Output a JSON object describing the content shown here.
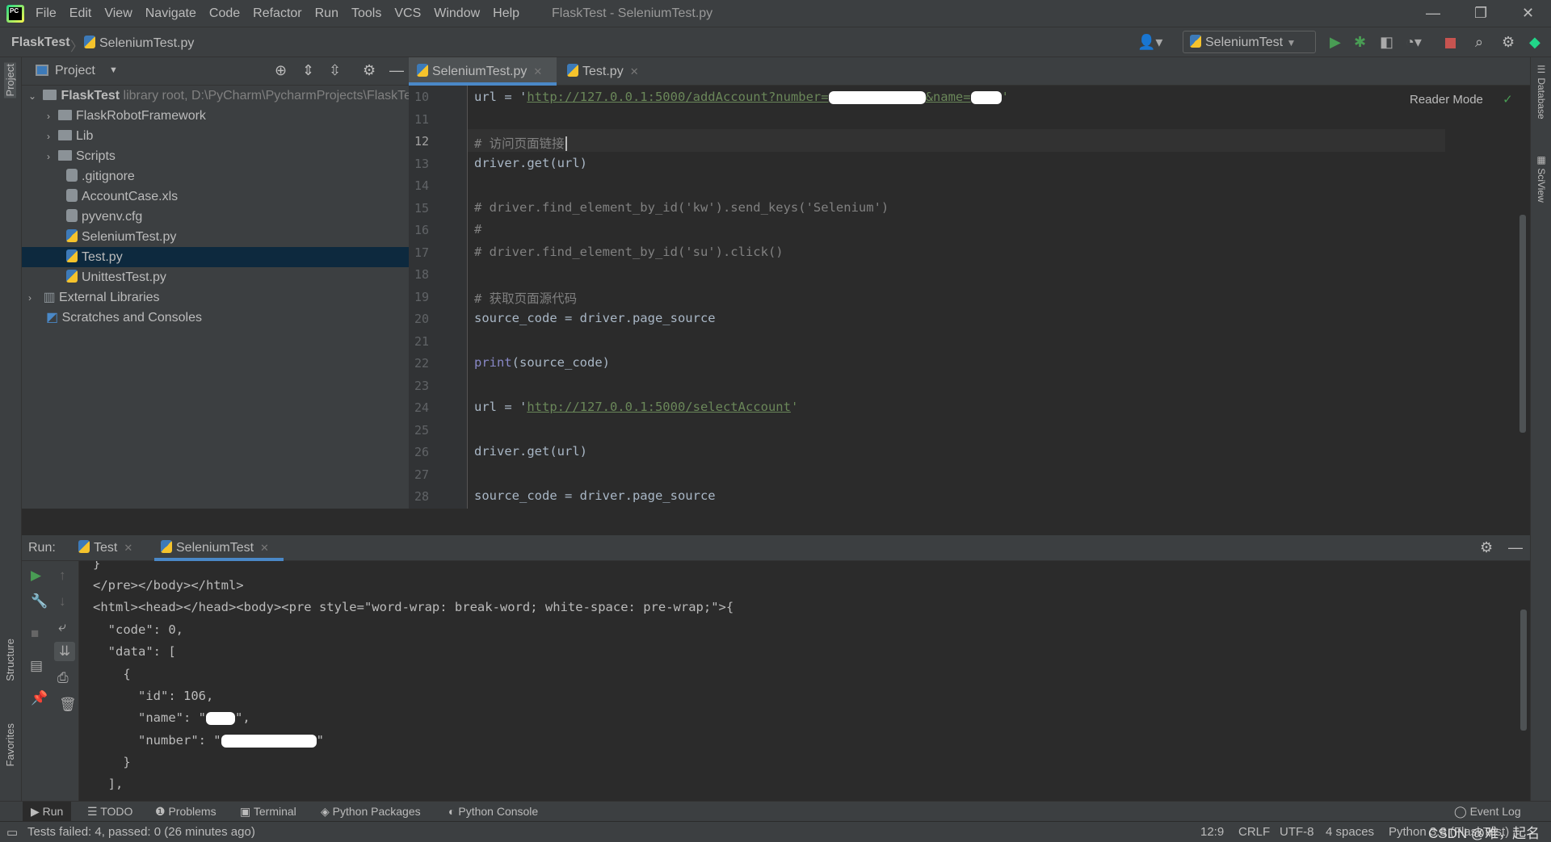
{
  "menubar": {
    "items": [
      "File",
      "Edit",
      "View",
      "Navigate",
      "Code",
      "Refactor",
      "Run",
      "Tools",
      "VCS",
      "Window",
      "Help"
    ],
    "title": "FlaskTest - SeleniumTest.py",
    "logo": "PC"
  },
  "navbar": {
    "project": "FlaskTest",
    "file": "SeleniumTest.py",
    "run_config": "SeleniumTest"
  },
  "project_panel": {
    "title": "Project",
    "items": [
      {
        "label": "FlaskTest",
        "extra": "library root,  D:\\PyCharm\\PycharmProjects\\FlaskTest",
        "type": "root"
      },
      {
        "label": "FlaskRobotFramework",
        "type": "folder"
      },
      {
        "label": "Lib",
        "type": "folder"
      },
      {
        "label": "Scripts",
        "type": "folder"
      },
      {
        "label": ".gitignore",
        "type": "file"
      },
      {
        "label": "AccountCase.xls",
        "type": "file"
      },
      {
        "label": "pyvenv.cfg",
        "type": "file"
      },
      {
        "label": "SeleniumTest.py",
        "type": "py"
      },
      {
        "label": "Test.py",
        "type": "py",
        "selected": true
      },
      {
        "label": "UnittestTest.py",
        "type": "py"
      },
      {
        "label": "External Libraries",
        "type": "lib"
      },
      {
        "label": "Scratches and Consoles",
        "type": "scratch"
      }
    ]
  },
  "editor": {
    "tabs": [
      "SeleniumTest.py",
      "Test.py"
    ],
    "active_tab": "SeleniumTest.py",
    "reader_mode": "Reader Mode",
    "line_numbers": [
      "10",
      "11",
      "12",
      "13",
      "14",
      "15",
      "16",
      "17",
      "18",
      "19",
      "20",
      "21",
      "22",
      "23",
      "24",
      "25",
      "26",
      "27",
      "28"
    ],
    "lines": {
      "l10a": "url = '",
      "l10b": "http://127.0.0.1:5000/addAccount?number=",
      "l10c": "&name=",
      "l12": "# 访问页面链接",
      "l13": "driver.get(url)",
      "l15": "# driver.find_element_by_id('kw').send_keys('Selenium')",
      "l16": "#",
      "l17": "# driver.find_element_by_id('su').click()",
      "l19": "# 获取页面源代码",
      "l20": "source_code = driver.page_source",
      "l22a": "print",
      "l22b": "(source_code)",
      "l24a": "url = '",
      "l24b": "http://127.0.0.1:5000/selectAccount",
      "l24c": "'",
      "l26": "driver.get(url)",
      "l28": "source_code = driver.page_source"
    }
  },
  "run_panel": {
    "label": "Run:",
    "tabs": [
      "Test",
      "SeleniumTest"
    ],
    "active_tab": "SeleniumTest",
    "output": [
      "}",
      "</pre></body></html>",
      "<html><head></head><body><pre style=\"word-wrap: break-word; white-space: pre-wrap;\">{",
      "  \"code\": 0,",
      "  \"data\": [",
      "    {",
      "      \"id\": 106,",
      "      \"name\": \"",
      "      \"number\": \"",
      "    }",
      "  ],"
    ]
  },
  "tool_windows": [
    "Run",
    "TODO",
    "Problems",
    "Terminal",
    "Python Packages",
    "Python Console"
  ],
  "event_log": "Event Log",
  "side_labels": {
    "project": "Project",
    "structure": "Structure",
    "favorites": "Favorites",
    "database": "Database",
    "sciview": "SciView"
  },
  "status": {
    "message": "Tests failed: 4, passed: 0 (26 minutes ago)",
    "position": "12:9",
    "line_sep": "CRLF",
    "encoding": "UTF-8",
    "indent": "4 spaces",
    "interpreter": "Python 3.8 (FlaskTest)",
    "watermark": "CSDN @难，起名"
  },
  "colors": {
    "accent": "#4a88c7",
    "run_green": "#499c54",
    "stop_red": "#c75450"
  }
}
